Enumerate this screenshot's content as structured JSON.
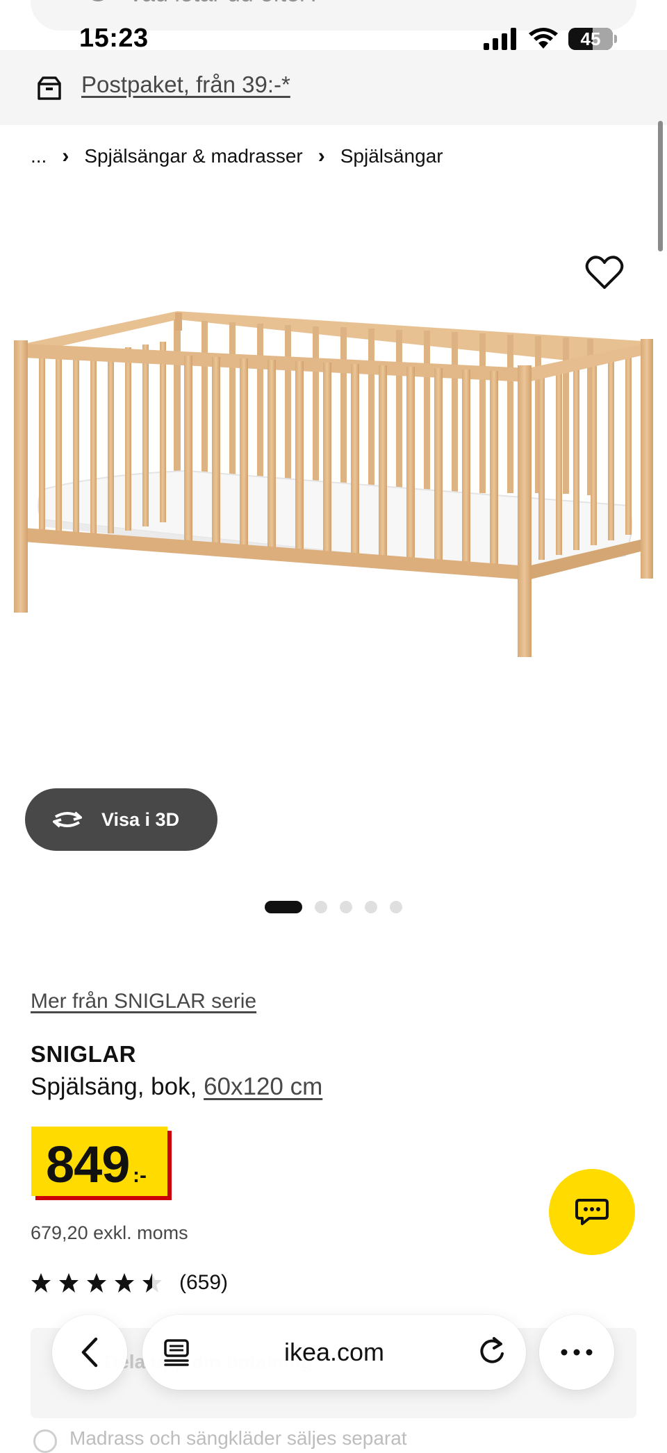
{
  "search": {
    "placeholder": "Vad letar du efter?"
  },
  "status_bar": {
    "time": "15:23",
    "battery": "45"
  },
  "delivery_banner": {
    "text": "Postpaket, från 39:-*"
  },
  "breadcrumb": {
    "items": [
      "...",
      "Spjälsängar & madrasser",
      "Spjälsängar"
    ]
  },
  "gallery": {
    "view_3d_label": "Visa i 3D",
    "slide_count": 5,
    "active_slide": 1
  },
  "product": {
    "series_link": "Mer från SNIGLAR serie",
    "name": "SNIGLAR",
    "description_prefix": "Spjälsäng, bok, ",
    "size": "60x120 cm",
    "price": "849",
    "price_suffix": ":-",
    "price_excl_vat": "679,20 exkl. moms",
    "rating_stars": 4.5,
    "rating_count": "(659)"
  },
  "klarna": {
    "text": "Dela upp din betalning"
  },
  "notice": {
    "text": "Madrass och sängkläder säljes separat"
  },
  "safari": {
    "domain": "ikea.com"
  },
  "colors": {
    "ikea_yellow": "#ffdb00",
    "price_red": "#cc0008",
    "button_dark": "#484848",
    "background_grey": "#f5f5f5"
  }
}
